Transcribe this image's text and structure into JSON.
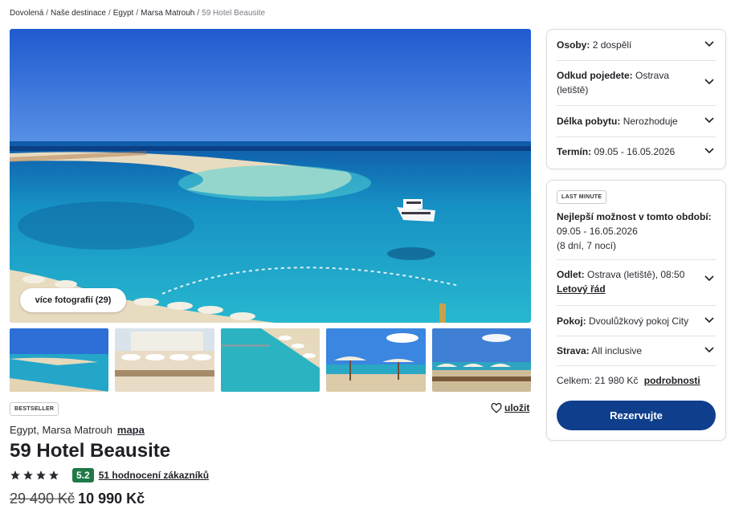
{
  "breadcrumb": {
    "items": [
      "Dovolená",
      "Naše destinace",
      "Egypt",
      "Marsa Matrouh"
    ],
    "current": "59 Hotel Beausite"
  },
  "gallery": {
    "more_photos_label": "více fotografií (29)"
  },
  "hotel": {
    "badge": "BESTSELLER",
    "save_label": "uložit",
    "location": "Egypt, Marsa Matrouh",
    "map_link": "mapa",
    "name": "59 Hotel Beausite",
    "stars": 4,
    "score": "5.2",
    "reviews_link": "51 hodnocení zákazníků",
    "old_price": "29 490 Kč",
    "new_price": "10 990 Kč"
  },
  "filters": {
    "persons": {
      "label": "Osoby:",
      "value": "2 dospělí"
    },
    "departure": {
      "label": "Odkud pojedete:",
      "value": "Ostrava (letiště)"
    },
    "length": {
      "label": "Délka pobytu:",
      "value": "Nerozhoduje"
    },
    "term": {
      "label": "Termín:",
      "value": "09.05 - 16.05.2026"
    }
  },
  "offer": {
    "badge": "LAST MINUTE",
    "best_label": "Nejlepší možnost v tomto období:",
    "dates": "09.05 - 16.05.2026",
    "duration": "(8 dní, 7 nocí)",
    "flight": {
      "label": "Odlet:",
      "value": "Ostrava (letiště), 08:50",
      "link": "Letový řád"
    },
    "room": {
      "label": "Pokoj:",
      "value": "Dvoulůžkový pokoj City"
    },
    "board": {
      "label": "Strava:",
      "value": "All inclusive"
    },
    "total": {
      "label": "Celkem: 21 980 Kč",
      "link": "podrobnosti"
    },
    "reserve_label": "Rezervujte"
  },
  "colors": {
    "primary_button": "#0f3f8c",
    "score_badge": "#1f7a45"
  }
}
